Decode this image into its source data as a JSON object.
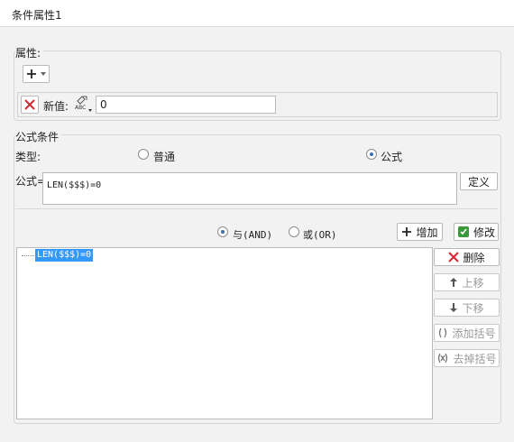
{
  "window": {
    "title": "条件属性1"
  },
  "properties": {
    "legend": "属性:",
    "new_value_label": "新值:",
    "new_value": "0"
  },
  "formula_condition": {
    "legend": "公式条件",
    "type_label": "类型:",
    "type_options": {
      "normal": "普通",
      "formula": "公式"
    },
    "type_selected": "公式",
    "formula_label": "公式=",
    "formula_value": "LEN($$$)=0",
    "define_button": "定义"
  },
  "logic": {
    "and_label": "与(AND)",
    "or_label": "或(OR)",
    "selected": "与(AND)",
    "add_button": "增加",
    "modify_button": "修改"
  },
  "condition_list": {
    "items": [
      "LEN($$$)=0"
    ],
    "selected_index": 0
  },
  "side_buttons": {
    "delete": "删除",
    "move_up": "上移",
    "move_down": "下移",
    "add_bracket": "添加括号",
    "remove_bracket": "去掉括号"
  },
  "colors": {
    "selection": "#3399ff",
    "delete_red": "#d9272e",
    "modify_green": "#3a9a3a",
    "accent_radio": "#3b6dbb"
  }
}
